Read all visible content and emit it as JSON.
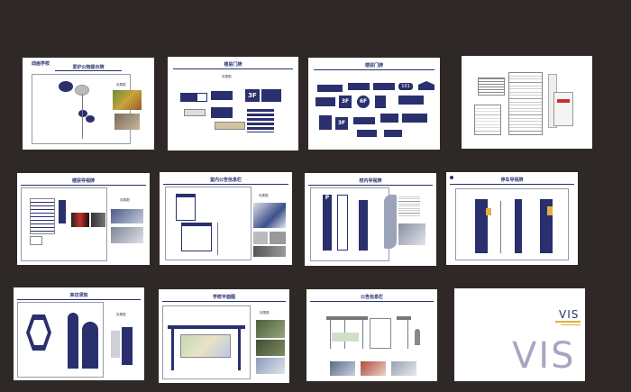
{
  "school_name": "动画学校",
  "boards": {
    "b1": {
      "title": "爱护公物提示牌",
      "note": "效果图"
    },
    "b2": {
      "title": "楼层门牌",
      "note": "效果图",
      "floor": "3F"
    },
    "b3": {
      "title": "楼层门牌",
      "floor_a": "3F",
      "floor_b": "6F",
      "room": "101",
      "floor_c": "3F"
    },
    "b4": {
      "title": ""
    },
    "b5": {
      "title": "楼层导视牌",
      "note": "效果图"
    },
    "b6": {
      "title": "室内公告信息栏",
      "note": "效果图"
    },
    "b7": {
      "title": "校内导视牌",
      "sign_letter": "P"
    },
    "b8": {
      "title": "停车导视牌"
    },
    "b9": {
      "title": "来访须知",
      "note": "效果图"
    },
    "b10": {
      "title": "学校平面图",
      "note": "效果图"
    },
    "b11": {
      "title": "公告信息栏"
    },
    "b12": {
      "vis_small": "VIS",
      "vis_big": "VIS"
    }
  },
  "colors": {
    "navy": "#2a2f6e",
    "background": "#2e2827",
    "vis_gray": "#a7a6c2"
  }
}
